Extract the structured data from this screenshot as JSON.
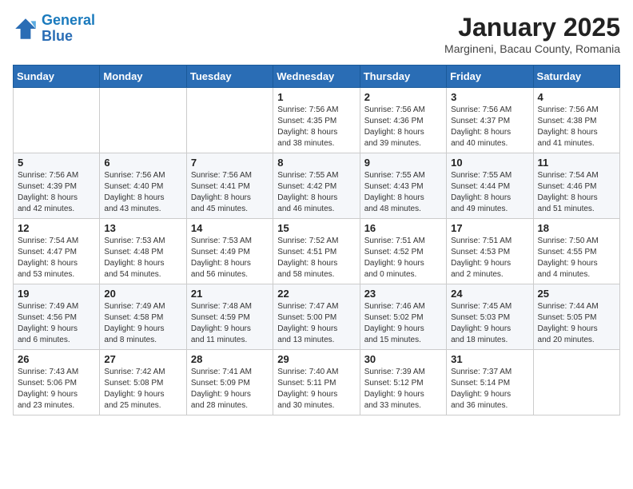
{
  "header": {
    "logo_line1": "General",
    "logo_line2": "Blue",
    "title": "January 2025",
    "subtitle": "Margineni, Bacau County, Romania"
  },
  "weekdays": [
    "Sunday",
    "Monday",
    "Tuesday",
    "Wednesday",
    "Thursday",
    "Friday",
    "Saturday"
  ],
  "weeks": [
    [
      {
        "day": "",
        "info": ""
      },
      {
        "day": "",
        "info": ""
      },
      {
        "day": "",
        "info": ""
      },
      {
        "day": "1",
        "info": "Sunrise: 7:56 AM\nSunset: 4:35 PM\nDaylight: 8 hours\nand 38 minutes."
      },
      {
        "day": "2",
        "info": "Sunrise: 7:56 AM\nSunset: 4:36 PM\nDaylight: 8 hours\nand 39 minutes."
      },
      {
        "day": "3",
        "info": "Sunrise: 7:56 AM\nSunset: 4:37 PM\nDaylight: 8 hours\nand 40 minutes."
      },
      {
        "day": "4",
        "info": "Sunrise: 7:56 AM\nSunset: 4:38 PM\nDaylight: 8 hours\nand 41 minutes."
      }
    ],
    [
      {
        "day": "5",
        "info": "Sunrise: 7:56 AM\nSunset: 4:39 PM\nDaylight: 8 hours\nand 42 minutes."
      },
      {
        "day": "6",
        "info": "Sunrise: 7:56 AM\nSunset: 4:40 PM\nDaylight: 8 hours\nand 43 minutes."
      },
      {
        "day": "7",
        "info": "Sunrise: 7:56 AM\nSunset: 4:41 PM\nDaylight: 8 hours\nand 45 minutes."
      },
      {
        "day": "8",
        "info": "Sunrise: 7:55 AM\nSunset: 4:42 PM\nDaylight: 8 hours\nand 46 minutes."
      },
      {
        "day": "9",
        "info": "Sunrise: 7:55 AM\nSunset: 4:43 PM\nDaylight: 8 hours\nand 48 minutes."
      },
      {
        "day": "10",
        "info": "Sunrise: 7:55 AM\nSunset: 4:44 PM\nDaylight: 8 hours\nand 49 minutes."
      },
      {
        "day": "11",
        "info": "Sunrise: 7:54 AM\nSunset: 4:46 PM\nDaylight: 8 hours\nand 51 minutes."
      }
    ],
    [
      {
        "day": "12",
        "info": "Sunrise: 7:54 AM\nSunset: 4:47 PM\nDaylight: 8 hours\nand 53 minutes."
      },
      {
        "day": "13",
        "info": "Sunrise: 7:53 AM\nSunset: 4:48 PM\nDaylight: 8 hours\nand 54 minutes."
      },
      {
        "day": "14",
        "info": "Sunrise: 7:53 AM\nSunset: 4:49 PM\nDaylight: 8 hours\nand 56 minutes."
      },
      {
        "day": "15",
        "info": "Sunrise: 7:52 AM\nSunset: 4:51 PM\nDaylight: 8 hours\nand 58 minutes."
      },
      {
        "day": "16",
        "info": "Sunrise: 7:51 AM\nSunset: 4:52 PM\nDaylight: 9 hours\nand 0 minutes."
      },
      {
        "day": "17",
        "info": "Sunrise: 7:51 AM\nSunset: 4:53 PM\nDaylight: 9 hours\nand 2 minutes."
      },
      {
        "day": "18",
        "info": "Sunrise: 7:50 AM\nSunset: 4:55 PM\nDaylight: 9 hours\nand 4 minutes."
      }
    ],
    [
      {
        "day": "19",
        "info": "Sunrise: 7:49 AM\nSunset: 4:56 PM\nDaylight: 9 hours\nand 6 minutes."
      },
      {
        "day": "20",
        "info": "Sunrise: 7:49 AM\nSunset: 4:58 PM\nDaylight: 9 hours\nand 8 minutes."
      },
      {
        "day": "21",
        "info": "Sunrise: 7:48 AM\nSunset: 4:59 PM\nDaylight: 9 hours\nand 11 minutes."
      },
      {
        "day": "22",
        "info": "Sunrise: 7:47 AM\nSunset: 5:00 PM\nDaylight: 9 hours\nand 13 minutes."
      },
      {
        "day": "23",
        "info": "Sunrise: 7:46 AM\nSunset: 5:02 PM\nDaylight: 9 hours\nand 15 minutes."
      },
      {
        "day": "24",
        "info": "Sunrise: 7:45 AM\nSunset: 5:03 PM\nDaylight: 9 hours\nand 18 minutes."
      },
      {
        "day": "25",
        "info": "Sunrise: 7:44 AM\nSunset: 5:05 PM\nDaylight: 9 hours\nand 20 minutes."
      }
    ],
    [
      {
        "day": "26",
        "info": "Sunrise: 7:43 AM\nSunset: 5:06 PM\nDaylight: 9 hours\nand 23 minutes."
      },
      {
        "day": "27",
        "info": "Sunrise: 7:42 AM\nSunset: 5:08 PM\nDaylight: 9 hours\nand 25 minutes."
      },
      {
        "day": "28",
        "info": "Sunrise: 7:41 AM\nSunset: 5:09 PM\nDaylight: 9 hours\nand 28 minutes."
      },
      {
        "day": "29",
        "info": "Sunrise: 7:40 AM\nSunset: 5:11 PM\nDaylight: 9 hours\nand 30 minutes."
      },
      {
        "day": "30",
        "info": "Sunrise: 7:39 AM\nSunset: 5:12 PM\nDaylight: 9 hours\nand 33 minutes."
      },
      {
        "day": "31",
        "info": "Sunrise: 7:37 AM\nSunset: 5:14 PM\nDaylight: 9 hours\nand 36 minutes."
      },
      {
        "day": "",
        "info": ""
      }
    ]
  ]
}
